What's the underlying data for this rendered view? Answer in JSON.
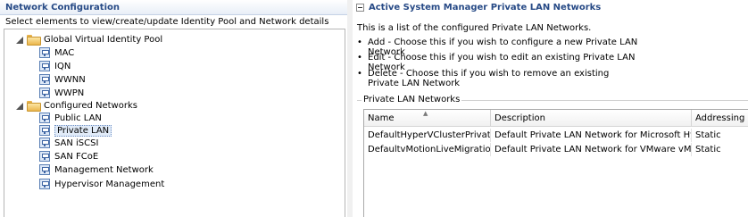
{
  "left": {
    "title": "Network Configuration",
    "subtitle": "Select elements to view/create/update Identity Pool and Network details",
    "tree": {
      "pool_label": "Global Virtual Identity Pool",
      "pool_items": [
        "MAC",
        "IQN",
        "WWNN",
        "WWPN"
      ],
      "networks_label": "Configured Networks",
      "network_items": [
        "Public LAN",
        "Private LAN",
        "SAN iSCSI",
        "SAN FCoE",
        "Management Network",
        "Hypervisor Management"
      ],
      "selected": "Private LAN"
    }
  },
  "right": {
    "title": "Active System Manager Private LAN Networks",
    "description": "This is a list of the configured Private LAN Networks.",
    "bullets": [
      "Add - Choose this if you wish to configure a new Private LAN Network",
      "Edit - Choose this if you wish to edit an existing Private LAN Network",
      "Delete - Choose this if you wish to remove an existing Private LAN Network"
    ],
    "group_label": "Private LAN Networks",
    "table": {
      "columns": [
        "Name",
        "Description",
        "Addressing"
      ],
      "rows": [
        [
          "DefaultHyperVClusterPrivate",
          "Default Private LAN Network for Microsoft Hyp...",
          "Static"
        ],
        [
          "DefaultvMotionLiveMigration",
          "Default Private LAN Network for VMware vMoti...",
          "Static"
        ]
      ]
    }
  },
  "colors": {
    "title_blue": "#274a86",
    "header_gradient_end": "#e8eef7",
    "selection_bg": "#e1ebf8"
  },
  "icons": {
    "tree_expander": "expand-triangle-icon",
    "folder": "folder-icon",
    "network_item": "network-icon",
    "section_collapse": "collapse-minus-icon"
  }
}
